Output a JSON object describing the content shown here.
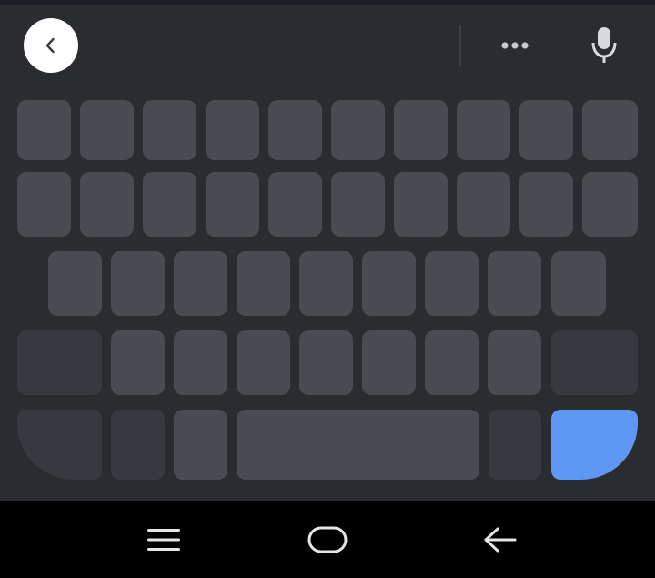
{
  "toolbar": {
    "back_icon": "chevron-left-icon",
    "more_icon": "more-horizontal-icon",
    "mic_icon": "microphone-icon"
  },
  "keyboard": {
    "key_color": "#4a4b50",
    "function_key_color": "#38393e",
    "enter_key_color": "#5f97f5",
    "background_color": "#2b2c30"
  },
  "nav_bar": {
    "recents_icon": "menu-lines-icon",
    "home_icon": "home-pill-icon",
    "back_icon": "back-arrow-icon"
  }
}
